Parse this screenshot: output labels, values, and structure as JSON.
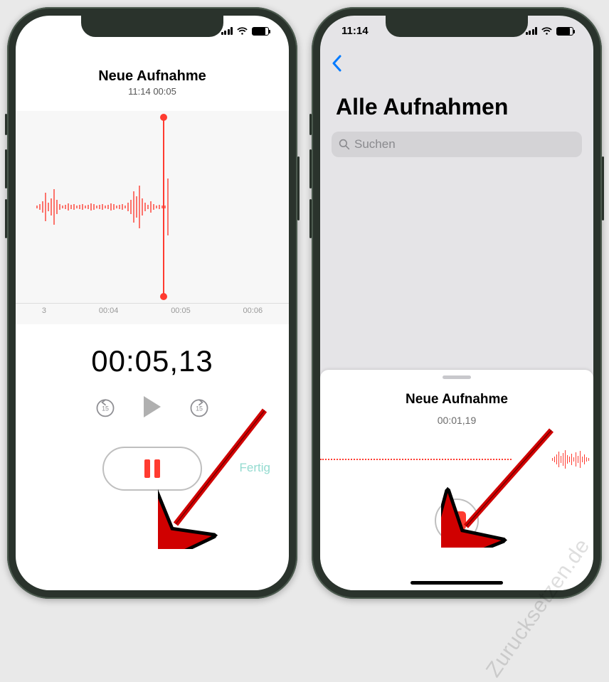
{
  "left": {
    "title": "Neue Aufnahme",
    "subtitle": "11:14  00:05",
    "timeline": {
      "a": "3",
      "b": "00:04",
      "c": "00:05",
      "d": "00:06"
    },
    "counter": "00:05,13",
    "skip_back": "15",
    "skip_fwd": "15",
    "done_label": "Fertig"
  },
  "right": {
    "status_time": "11:14",
    "list_title": "Alle Aufnahmen",
    "search_placeholder": "Suchen",
    "sheet_title": "Neue Aufnahme",
    "sheet_timer": "00:01,19"
  },
  "watermark": "Zurucksetzen.de"
}
